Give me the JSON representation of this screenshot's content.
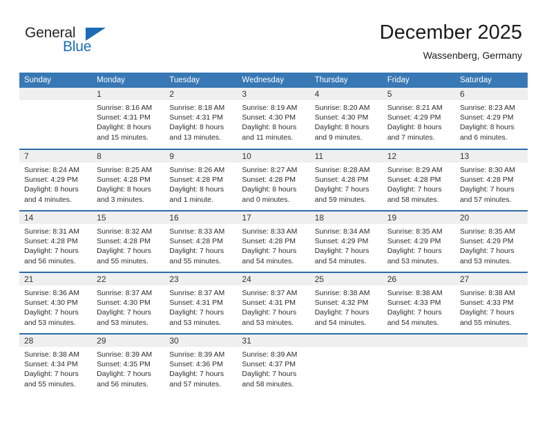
{
  "logo": {
    "word_one": "General",
    "word_two": "Blue",
    "accent_color": "#1b6cb5",
    "triangle_icon": "triangle-icon"
  },
  "header": {
    "title": "December 2025",
    "location": "Wassenberg, Germany",
    "header_bg": "#3878b4",
    "separator_color": "#2b6ca8",
    "daynum_bg": "#efefef"
  },
  "weekday_headers": [
    "Sunday",
    "Monday",
    "Tuesday",
    "Wednesday",
    "Thursday",
    "Friday",
    "Saturday"
  ],
  "weeks": [
    [
      {
        "day": "",
        "sunrise": "",
        "sunset": "",
        "daylight_line1": "",
        "daylight_line2": "",
        "empty": true
      },
      {
        "day": "1",
        "sunrise": "Sunrise: 8:16 AM",
        "sunset": "Sunset: 4:31 PM",
        "daylight_line1": "Daylight: 8 hours",
        "daylight_line2": "and 15 minutes.",
        "empty": false
      },
      {
        "day": "2",
        "sunrise": "Sunrise: 8:18 AM",
        "sunset": "Sunset: 4:31 PM",
        "daylight_line1": "Daylight: 8 hours",
        "daylight_line2": "and 13 minutes.",
        "empty": false
      },
      {
        "day": "3",
        "sunrise": "Sunrise: 8:19 AM",
        "sunset": "Sunset: 4:30 PM",
        "daylight_line1": "Daylight: 8 hours",
        "daylight_line2": "and 11 minutes.",
        "empty": false
      },
      {
        "day": "4",
        "sunrise": "Sunrise: 8:20 AM",
        "sunset": "Sunset: 4:30 PM",
        "daylight_line1": "Daylight: 8 hours",
        "daylight_line2": "and 9 minutes.",
        "empty": false
      },
      {
        "day": "5",
        "sunrise": "Sunrise: 8:21 AM",
        "sunset": "Sunset: 4:29 PM",
        "daylight_line1": "Daylight: 8 hours",
        "daylight_line2": "and 7 minutes.",
        "empty": false
      },
      {
        "day": "6",
        "sunrise": "Sunrise: 8:23 AM",
        "sunset": "Sunset: 4:29 PM",
        "daylight_line1": "Daylight: 8 hours",
        "daylight_line2": "and 6 minutes.",
        "empty": false
      }
    ],
    [
      {
        "day": "7",
        "sunrise": "Sunrise: 8:24 AM",
        "sunset": "Sunset: 4:29 PM",
        "daylight_line1": "Daylight: 8 hours",
        "daylight_line2": "and 4 minutes.",
        "empty": false
      },
      {
        "day": "8",
        "sunrise": "Sunrise: 8:25 AM",
        "sunset": "Sunset: 4:28 PM",
        "daylight_line1": "Daylight: 8 hours",
        "daylight_line2": "and 3 minutes.",
        "empty": false
      },
      {
        "day": "9",
        "sunrise": "Sunrise: 8:26 AM",
        "sunset": "Sunset: 4:28 PM",
        "daylight_line1": "Daylight: 8 hours",
        "daylight_line2": "and 1 minute.",
        "empty": false
      },
      {
        "day": "10",
        "sunrise": "Sunrise: 8:27 AM",
        "sunset": "Sunset: 4:28 PM",
        "daylight_line1": "Daylight: 8 hours",
        "daylight_line2": "and 0 minutes.",
        "empty": false
      },
      {
        "day": "11",
        "sunrise": "Sunrise: 8:28 AM",
        "sunset": "Sunset: 4:28 PM",
        "daylight_line1": "Daylight: 7 hours",
        "daylight_line2": "and 59 minutes.",
        "empty": false
      },
      {
        "day": "12",
        "sunrise": "Sunrise: 8:29 AM",
        "sunset": "Sunset: 4:28 PM",
        "daylight_line1": "Daylight: 7 hours",
        "daylight_line2": "and 58 minutes.",
        "empty": false
      },
      {
        "day": "13",
        "sunrise": "Sunrise: 8:30 AM",
        "sunset": "Sunset: 4:28 PM",
        "daylight_line1": "Daylight: 7 hours",
        "daylight_line2": "and 57 minutes.",
        "empty": false
      }
    ],
    [
      {
        "day": "14",
        "sunrise": "Sunrise: 8:31 AM",
        "sunset": "Sunset: 4:28 PM",
        "daylight_line1": "Daylight: 7 hours",
        "daylight_line2": "and 56 minutes.",
        "empty": false
      },
      {
        "day": "15",
        "sunrise": "Sunrise: 8:32 AM",
        "sunset": "Sunset: 4:28 PM",
        "daylight_line1": "Daylight: 7 hours",
        "daylight_line2": "and 55 minutes.",
        "empty": false
      },
      {
        "day": "16",
        "sunrise": "Sunrise: 8:33 AM",
        "sunset": "Sunset: 4:28 PM",
        "daylight_line1": "Daylight: 7 hours",
        "daylight_line2": "and 55 minutes.",
        "empty": false
      },
      {
        "day": "17",
        "sunrise": "Sunrise: 8:33 AM",
        "sunset": "Sunset: 4:28 PM",
        "daylight_line1": "Daylight: 7 hours",
        "daylight_line2": "and 54 minutes.",
        "empty": false
      },
      {
        "day": "18",
        "sunrise": "Sunrise: 8:34 AM",
        "sunset": "Sunset: 4:29 PM",
        "daylight_line1": "Daylight: 7 hours",
        "daylight_line2": "and 54 minutes.",
        "empty": false
      },
      {
        "day": "19",
        "sunrise": "Sunrise: 8:35 AM",
        "sunset": "Sunset: 4:29 PM",
        "daylight_line1": "Daylight: 7 hours",
        "daylight_line2": "and 53 minutes.",
        "empty": false
      },
      {
        "day": "20",
        "sunrise": "Sunrise: 8:35 AM",
        "sunset": "Sunset: 4:29 PM",
        "daylight_line1": "Daylight: 7 hours",
        "daylight_line2": "and 53 minutes.",
        "empty": false
      }
    ],
    [
      {
        "day": "21",
        "sunrise": "Sunrise: 8:36 AM",
        "sunset": "Sunset: 4:30 PM",
        "daylight_line1": "Daylight: 7 hours",
        "daylight_line2": "and 53 minutes.",
        "empty": false
      },
      {
        "day": "22",
        "sunrise": "Sunrise: 8:37 AM",
        "sunset": "Sunset: 4:30 PM",
        "daylight_line1": "Daylight: 7 hours",
        "daylight_line2": "and 53 minutes.",
        "empty": false
      },
      {
        "day": "23",
        "sunrise": "Sunrise: 8:37 AM",
        "sunset": "Sunset: 4:31 PM",
        "daylight_line1": "Daylight: 7 hours",
        "daylight_line2": "and 53 minutes.",
        "empty": false
      },
      {
        "day": "24",
        "sunrise": "Sunrise: 8:37 AM",
        "sunset": "Sunset: 4:31 PM",
        "daylight_line1": "Daylight: 7 hours",
        "daylight_line2": "and 53 minutes.",
        "empty": false
      },
      {
        "day": "25",
        "sunrise": "Sunrise: 8:38 AM",
        "sunset": "Sunset: 4:32 PM",
        "daylight_line1": "Daylight: 7 hours",
        "daylight_line2": "and 54 minutes.",
        "empty": false
      },
      {
        "day": "26",
        "sunrise": "Sunrise: 8:38 AM",
        "sunset": "Sunset: 4:33 PM",
        "daylight_line1": "Daylight: 7 hours",
        "daylight_line2": "and 54 minutes.",
        "empty": false
      },
      {
        "day": "27",
        "sunrise": "Sunrise: 8:38 AM",
        "sunset": "Sunset: 4:33 PM",
        "daylight_line1": "Daylight: 7 hours",
        "daylight_line2": "and 55 minutes.",
        "empty": false
      }
    ],
    [
      {
        "day": "28",
        "sunrise": "Sunrise: 8:38 AM",
        "sunset": "Sunset: 4:34 PM",
        "daylight_line1": "Daylight: 7 hours",
        "daylight_line2": "and 55 minutes.",
        "empty": false
      },
      {
        "day": "29",
        "sunrise": "Sunrise: 8:39 AM",
        "sunset": "Sunset: 4:35 PM",
        "daylight_line1": "Daylight: 7 hours",
        "daylight_line2": "and 56 minutes.",
        "empty": false
      },
      {
        "day": "30",
        "sunrise": "Sunrise: 8:39 AM",
        "sunset": "Sunset: 4:36 PM",
        "daylight_line1": "Daylight: 7 hours",
        "daylight_line2": "and 57 minutes.",
        "empty": false
      },
      {
        "day": "31",
        "sunrise": "Sunrise: 8:39 AM",
        "sunset": "Sunset: 4:37 PM",
        "daylight_line1": "Daylight: 7 hours",
        "daylight_line2": "and 58 minutes.",
        "empty": false
      },
      {
        "day": "",
        "sunrise": "",
        "sunset": "",
        "daylight_line1": "",
        "daylight_line2": "",
        "empty": true
      },
      {
        "day": "",
        "sunrise": "",
        "sunset": "",
        "daylight_line1": "",
        "daylight_line2": "",
        "empty": true
      },
      {
        "day": "",
        "sunrise": "",
        "sunset": "",
        "daylight_line1": "",
        "daylight_line2": "",
        "empty": true
      }
    ]
  ]
}
